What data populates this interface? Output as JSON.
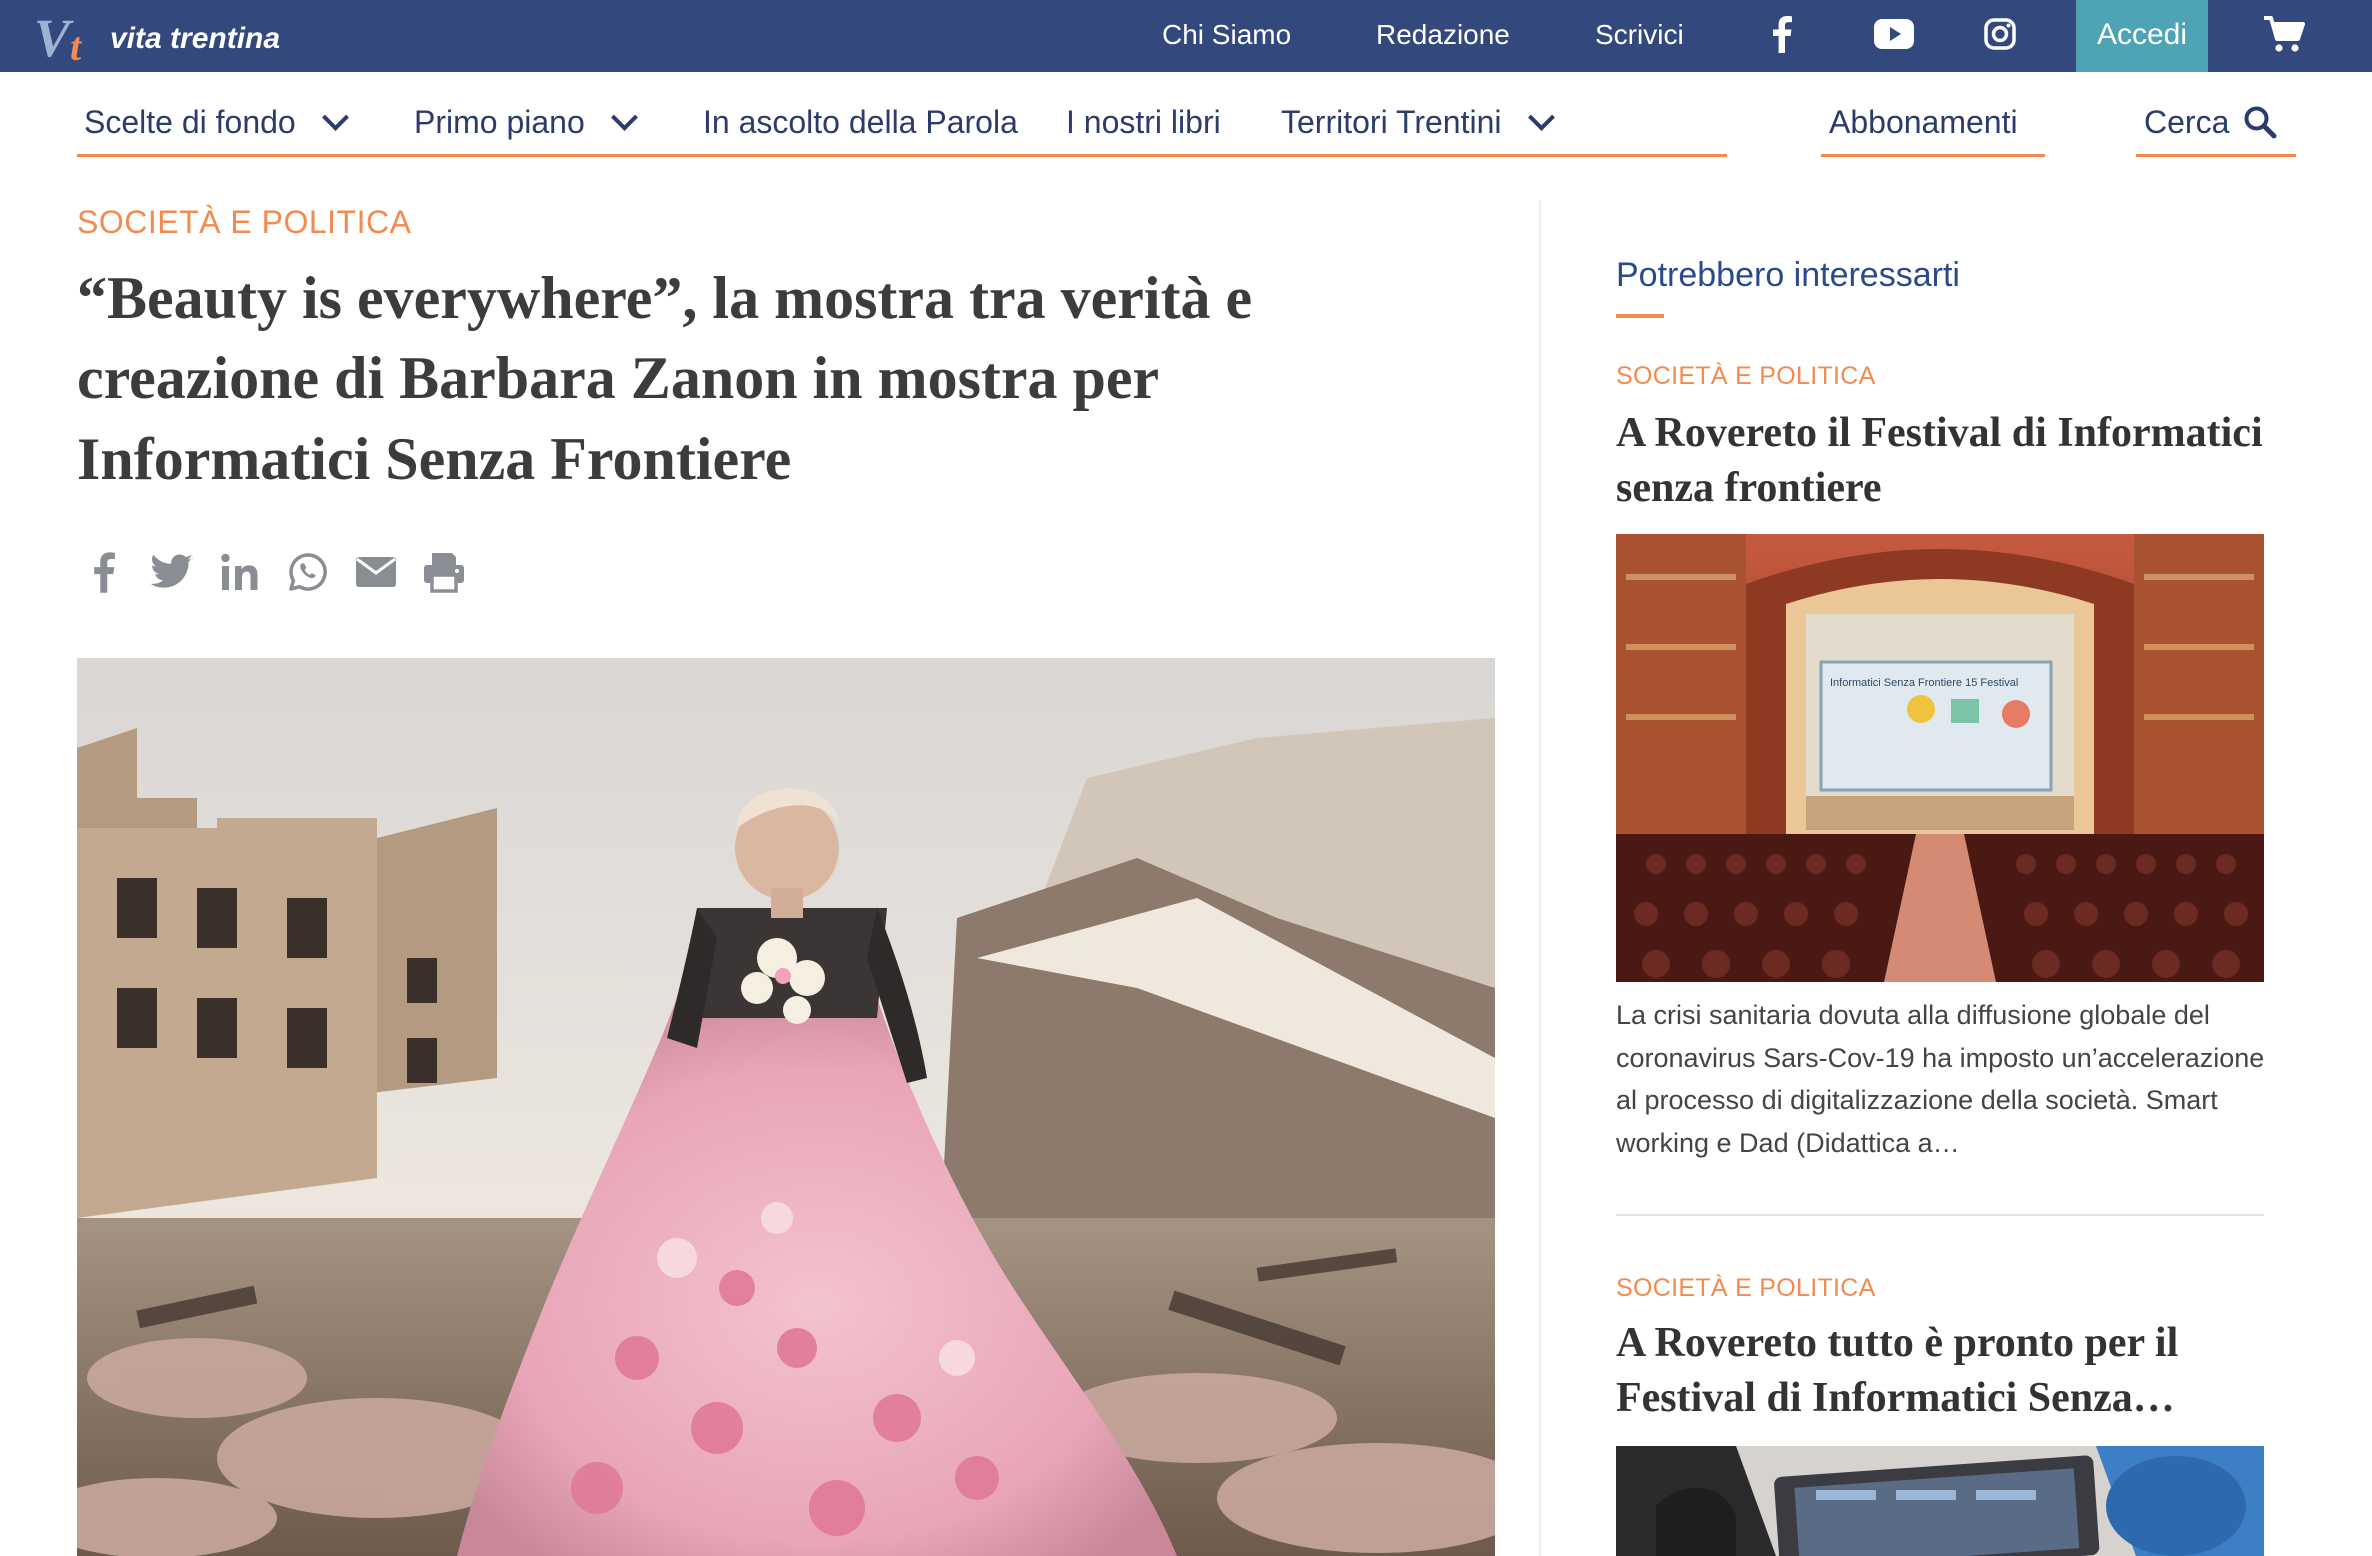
{
  "topbar": {
    "logo_mark_v": "V",
    "logo_mark_t": "t",
    "logo_text": "vita trentina",
    "links": [
      "Chi Siamo",
      "Redazione",
      "Scrivici"
    ],
    "login_label": "Accedi",
    "social_icons": [
      "facebook-icon",
      "youtube-icon",
      "instagram-icon"
    ],
    "cart_icon": "shopping-cart-icon",
    "background_color": "#33487c",
    "login_background_color": "#4ea4b4"
  },
  "main_nav": {
    "items": [
      "Scelte di fondo",
      "Primo piano",
      "In ascolto della Parola",
      "I nostri libri",
      "Territori Trentini"
    ],
    "subscriptions_label": "Abbonamenti",
    "search_label": "Cerca",
    "dropdown_icon": "chevron-down-icon",
    "search_icon": "search-icon",
    "text_color": "#2b3c6b",
    "accent_color": "#f28b4f"
  },
  "article": {
    "category": "SOCIETÀ E POLITICA",
    "title": "“Beauty is everywhere”, la mostra tra verità e creazione di Barbara Zanon in mostra per Informatici Senza Frontiere",
    "share_icons": [
      "facebook-icon",
      "twitter-icon",
      "linkedin-icon",
      "whatsapp-icon",
      "email-icon",
      "print-icon"
    ],
    "hero_image": "photo: older woman in a pink floral ball gown standing among rubble of ruined buildings"
  },
  "sidebar": {
    "title": "Potrebbero interessarti",
    "items": [
      {
        "category": "SOCIETÀ E POLITICA",
        "title": "A Rovereto il Festival di Informatici senza frontiere",
        "image": "photo: theater auditorium with audience facing a stage screen",
        "screen_text": "Informatici Senza Frontiere 15 Festival",
        "excerpt": "La crisi sanitaria dovuta alla diffusione globale del coronavirus Sars-Cov-19 ha imposto un’accelerazione al processo di digitalizzazione della società. Smart working e Dad (Didattica a…"
      },
      {
        "category": "SOCIETÀ E POLITICA",
        "title": "A Rovereto tutto è pronto per il Festival di Informatici Senza…",
        "image": "photo: hands repairing an open laptop"
      }
    ]
  }
}
